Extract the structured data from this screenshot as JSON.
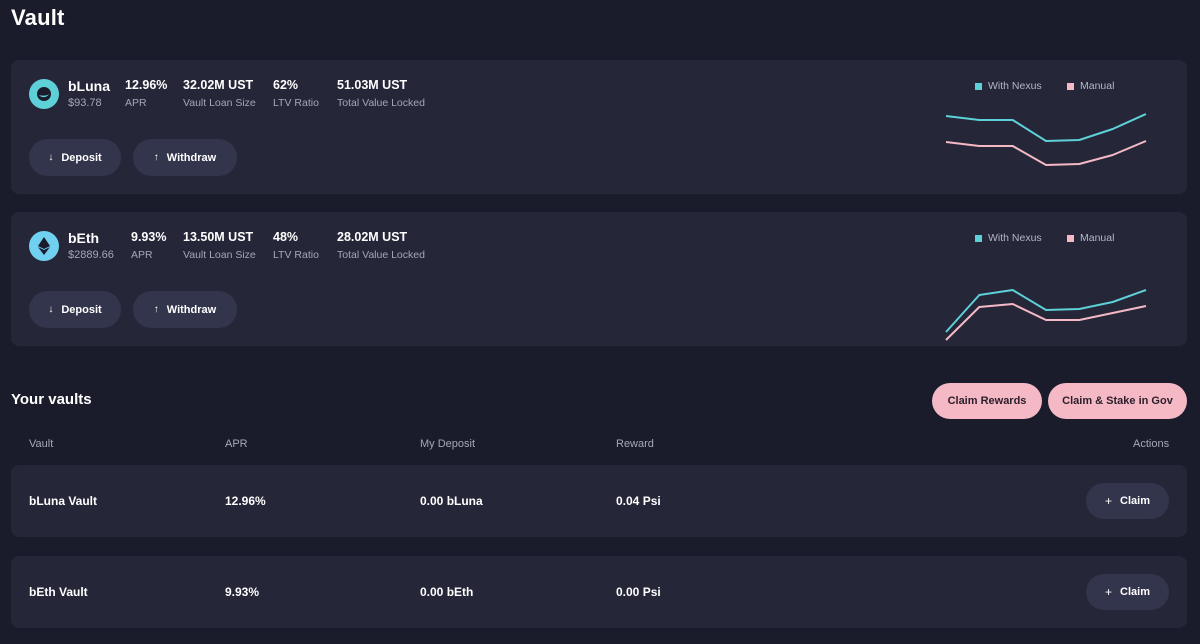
{
  "page": {
    "title": "Vault"
  },
  "colors": {
    "background": "#1b1c2b",
    "card": "#252638",
    "button": "#33354c",
    "nexus": "#5ed0d8",
    "manual": "#f5b9c6"
  },
  "vaults": [
    {
      "token": "bLuna",
      "price": "$93.78",
      "icon": "luna-icon",
      "stats": [
        {
          "value": "12.96%",
          "label": "APR"
        },
        {
          "value": "32.02M UST",
          "label": "Vault Loan Size"
        },
        {
          "value": "62%",
          "label": "LTV Ratio"
        },
        {
          "value": "51.03M UST",
          "label": "Total Value Locked"
        }
      ],
      "deposit_label": "Deposit",
      "withdraw_label": "Withdraw",
      "legend": {
        "nexus": "With Nexus",
        "manual": "Manual"
      }
    },
    {
      "token": "bEth",
      "price": "$2889.66",
      "icon": "ethereum-icon",
      "stats": [
        {
          "value": "9.93%",
          "label": "APR"
        },
        {
          "value": "13.50M UST",
          "label": "Vault Loan Size"
        },
        {
          "value": "48%",
          "label": "LTV Ratio"
        },
        {
          "value": "28.02M UST",
          "label": "Total Value Locked"
        }
      ],
      "deposit_label": "Deposit",
      "withdraw_label": "Withdraw",
      "legend": {
        "nexus": "With Nexus",
        "manual": "Manual"
      }
    }
  ],
  "chart_data": [
    {
      "type": "line",
      "title": "",
      "xlabel": "",
      "ylabel": "",
      "x": [
        0,
        1,
        2,
        3,
        4,
        5,
        6
      ],
      "ylim": [
        0,
        100
      ],
      "series": [
        {
          "name": "With Nexus",
          "color": "#5ed0d8",
          "values": [
            74,
            70,
            70,
            49,
            50,
            61,
            76
          ]
        },
        {
          "name": "Manual",
          "color": "#f5b9c6",
          "values": [
            48,
            44,
            44,
            25,
            26,
            35,
            49
          ]
        }
      ]
    },
    {
      "type": "line",
      "title": "",
      "xlabel": "",
      "ylabel": "",
      "x": [
        0,
        1,
        2,
        3,
        4,
        5,
        6
      ],
      "ylim": [
        0,
        100
      ],
      "series": [
        {
          "name": "With Nexus",
          "color": "#5ed0d8",
          "values": [
            10,
            47,
            52,
            32,
            33,
            40,
            52
          ]
        },
        {
          "name": "Manual",
          "color": "#f5b9c6",
          "values": [
            2,
            35,
            38,
            22,
            22,
            29,
            36
          ]
        }
      ]
    }
  ],
  "your_vaults": {
    "title": "Your vaults",
    "claim_rewards_label": "Claim Rewards",
    "claim_stake_label": "Claim & Stake in Gov",
    "columns": [
      "Vault",
      "APR",
      "My Deposit",
      "Reward",
      "Actions"
    ],
    "rows": [
      {
        "vault": "bLuna Vault",
        "apr": "12.96%",
        "deposit": "0.00 bLuna",
        "reward": "0.04 Psi",
        "action": "Claim"
      },
      {
        "vault": "bEth Vault",
        "apr": "9.93%",
        "deposit": "0.00 bEth",
        "reward": "0.00 Psi",
        "action": "Claim"
      }
    ]
  }
}
